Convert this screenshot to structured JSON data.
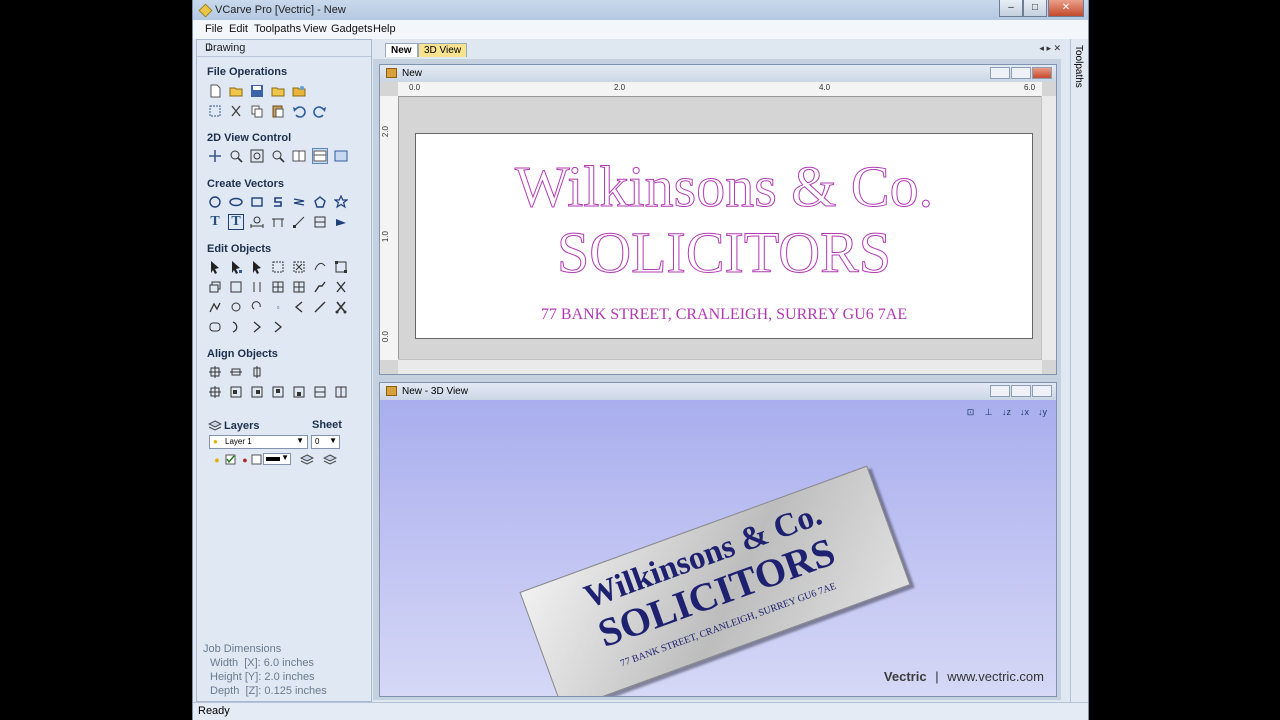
{
  "window": {
    "title": "VCarve Pro [Vectric] - New",
    "min": "–",
    "max": "□",
    "close": "✕"
  },
  "menu": [
    "File",
    "Edit",
    "Toolpaths",
    "View",
    "Gadgets",
    "Help"
  ],
  "panel": {
    "title": "Drawing",
    "pin": "⊥",
    "sections": {
      "file_ops": "File Operations",
      "view_ctrl": "2D View Control",
      "create": "Create Vectors",
      "edit": "Edit Objects",
      "align": "Align Objects"
    },
    "layers": {
      "label": "Layers",
      "sheet_label": "Sheet",
      "layer_value": "Layer 1",
      "sheet_value": "0"
    },
    "job": {
      "title": "Job Dimensions",
      "width": "Width  [X]: 6.0 inches",
      "height": "Height [Y]: 2.0 inches",
      "depth": "Depth  [Z]: 0.125 inches"
    }
  },
  "tabs": [
    {
      "label": "New",
      "active": true
    },
    {
      "label": "3D View",
      "active": false
    }
  ],
  "view2d": {
    "title": "New",
    "hticks": [
      "0.0",
      "2.0",
      "4.0",
      "6.0"
    ],
    "vticks": [
      "2.0",
      "1.0",
      "0.0"
    ],
    "line1": "Wilkinsons & Co.",
    "line2": "SOLICITORS",
    "line3": "77 BANK STREET, CRANLEIGH, SURREY GU6 7AE"
  },
  "view3d": {
    "title": "New - 3D View",
    "line1": "Wilkinsons & Co.",
    "line2": "SOLICITORS",
    "line3": "77 BANK STREET, CRANLEIGH, SURREY GU6 7AE",
    "brand_name": "Vectric",
    "brand_sep": "|",
    "brand_url": "www.vectric.com"
  },
  "rightstrip": "Toolpaths",
  "status": "Ready",
  "colors": {
    "outline": "#b13ab3",
    "navy": "#1d2170",
    "bg3d": "#b5b9f0"
  }
}
